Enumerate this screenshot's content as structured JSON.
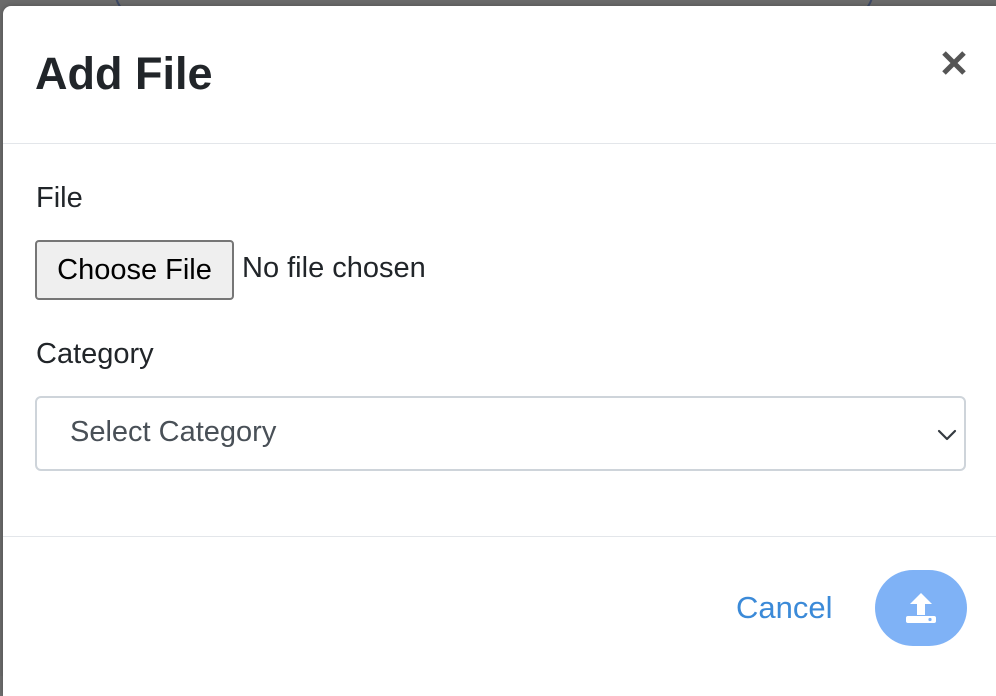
{
  "modal": {
    "title": "Add File",
    "close_icon": "close-icon"
  },
  "form": {
    "file_label": "File",
    "choose_file_button": "Choose File",
    "no_file_text": "No file chosen",
    "category_label": "Category",
    "category_select_value": "Select Category",
    "select_icon": "chevron-down-icon"
  },
  "footer": {
    "cancel_label": "Cancel",
    "upload_icon": "upload-icon"
  },
  "colors": {
    "primary": "#7fb2f6",
    "link": "#3b8ad8",
    "text": "#212529"
  }
}
